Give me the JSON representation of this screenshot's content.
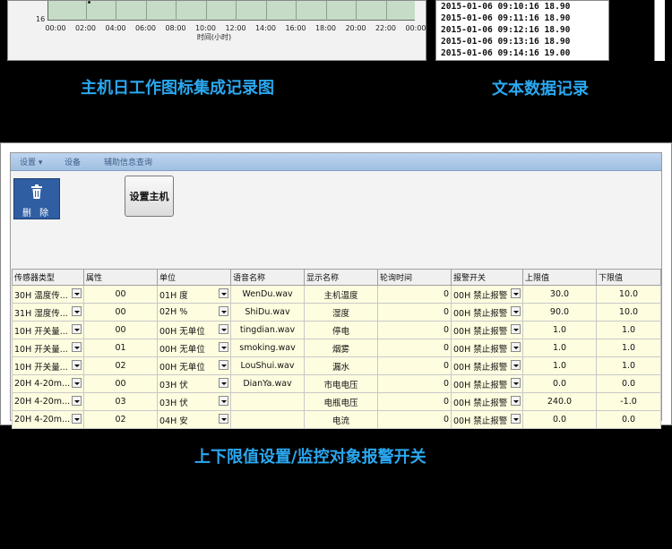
{
  "chart_panel": {
    "y_tick": "16",
    "x_ticks": [
      "00:00",
      "02:00",
      "04:00",
      "06:00",
      "08:00",
      "10:00",
      "12:00",
      "14:00",
      "16:00",
      "18:00",
      "20:00",
      "22:00",
      "00:00"
    ],
    "x_label": "时间(小时)"
  },
  "log_panel": {
    "lines": [
      "2015-01-06 09:10:16 18.90",
      "2015-01-06 09:11:16 18.90",
      "2015-01-06 09:12:16 18.90",
      "2015-01-06 09:13:16 18.90",
      "2015-01-06 09:14:16 19.00"
    ]
  },
  "captions": {
    "chart": "主机日工作图标集成记录图",
    "log": "文本数据记录",
    "settings": "上下限值设置/监控对象报警开关"
  },
  "toolbar": {
    "menu_items": [
      "设置  ▾",
      "设备",
      "辅助信息查询"
    ],
    "delete_label": "删 除",
    "set_host_label": "设置主机"
  },
  "table": {
    "headers": [
      "传感器类型",
      "属性",
      "单位",
      "语音名称",
      "显示名称",
      "轮询时间",
      "报警开关",
      "上限值",
      "下限值"
    ],
    "rows": [
      [
        "30H 温度传...",
        "00",
        "01H 度",
        "WenDu.wav",
        "主机温度",
        "0",
        "00H 禁止报警",
        "30.0",
        "10.0"
      ],
      [
        "31H 湿度传...",
        "00",
        "02H %",
        "ShiDu.wav",
        "湿度",
        "0",
        "00H 禁止报警",
        "90.0",
        "10.0"
      ],
      [
        "10H 开关量...",
        "00",
        "00H 无单位",
        "tingdian.wav",
        "停电",
        "0",
        "00H 禁止报警",
        "1.0",
        "1.0"
      ],
      [
        "10H 开关量...",
        "01",
        "00H 无单位",
        "smoking.wav",
        "烟雾",
        "0",
        "00H 禁止报警",
        "1.0",
        "1.0"
      ],
      [
        "10H 开关量...",
        "02",
        "00H 无单位",
        "LouShui.wav",
        "漏水",
        "0",
        "00H 禁止报警",
        "1.0",
        "1.0"
      ],
      [
        "20H 4-20m...",
        "00",
        "03H 伏",
        "DianYa.wav",
        "市电电压",
        "0",
        "00H 禁止报警",
        "0.0",
        "0.0"
      ],
      [
        "20H 4-20m...",
        "03",
        "03H 伏",
        "",
        "电瓶电压",
        "0",
        "00H 禁止报警",
        "240.0",
        "-1.0"
      ],
      [
        "20H 4-20m...",
        "02",
        "04H 安",
        "",
        "电流",
        "0",
        "00H 禁止报警",
        "0.0",
        "0.0"
      ]
    ]
  }
}
